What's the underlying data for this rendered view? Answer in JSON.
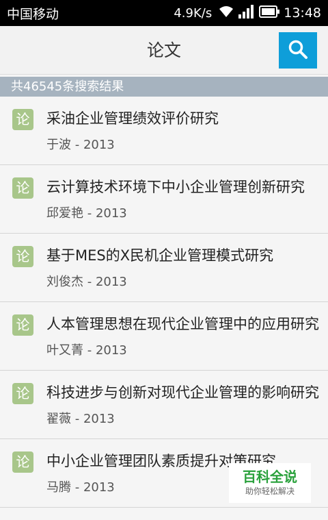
{
  "status_bar": {
    "carrier": "中国移动",
    "speed": "4.9K/s",
    "time": "13:48",
    "icons": [
      "wifi-icon",
      "signal-icon",
      "battery-icon"
    ]
  },
  "header": {
    "title": "论文",
    "search_icon": "search-icon",
    "accent_color": "#0e9ed9"
  },
  "result_count": "共46545条搜索结果",
  "items": [
    {
      "icon": "论",
      "title": "采油企业管理绩效评价研究",
      "author": "于波",
      "year": "2013"
    },
    {
      "icon": "论",
      "title": "云计算技术环境下中小企业管理创新研究",
      "author": "邱爱艳",
      "year": "2013"
    },
    {
      "icon": "论",
      "title": "基于MES的X民机企业管理模式研究",
      "author": "刘俊杰",
      "year": "2013"
    },
    {
      "icon": "论",
      "title": "人本管理思想在现代企业管理中的应用研究",
      "author": "叶又菁",
      "year": "2013"
    },
    {
      "icon": "论",
      "title": "科技进步与创新对现代企业管理的影响研究",
      "author": "翟薇",
      "year": "2013"
    },
    {
      "icon": "论",
      "title": "中小企业管理团队素质提升对策研究",
      "author": "马腾",
      "year": "2013"
    }
  ],
  "watermark": {
    "logo": "百科全说",
    "sub": "助你轻松解决"
  }
}
